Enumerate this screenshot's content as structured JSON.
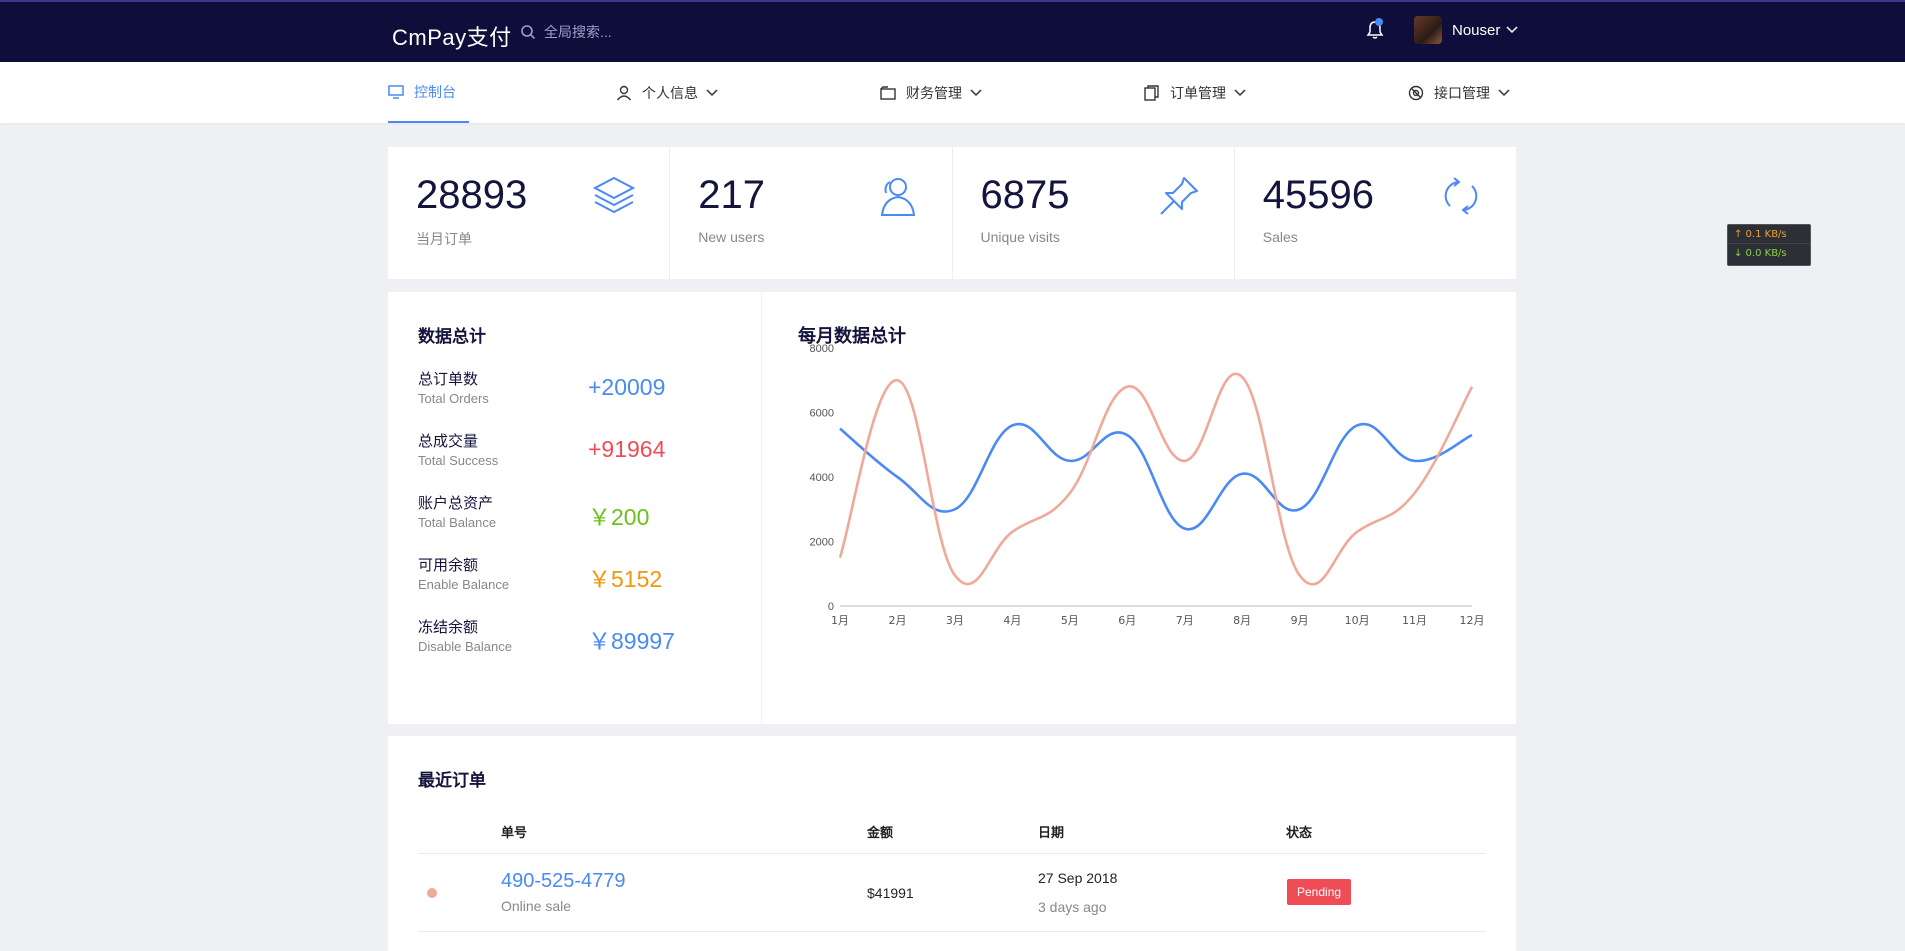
{
  "header": {
    "logo": "CmPay支付",
    "search_placeholder": "全局搜索...",
    "username": "Nouser"
  },
  "nav": [
    {
      "label": "控制台",
      "icon": "monitor-icon",
      "active": true
    },
    {
      "label": "个人信息",
      "icon": "user-icon"
    },
    {
      "label": "财务管理",
      "icon": "wallet-icon"
    },
    {
      "label": "订单管理",
      "icon": "document-copy-icon"
    },
    {
      "label": "接口管理",
      "icon": "api-icon"
    }
  ],
  "stats": [
    {
      "value": "28893",
      "label": "当月订单",
      "icon": "layers-icon"
    },
    {
      "value": "217",
      "label": "New users",
      "icon": "users-icon"
    },
    {
      "value": "6875",
      "label": "Unique visits",
      "icon": "pin-icon"
    },
    {
      "value": "45596",
      "label": "Sales",
      "icon": "refresh-icon"
    }
  ],
  "summary": {
    "title": "数据总计",
    "rows": [
      {
        "cn": "总订单数",
        "en": "Total Orders",
        "value": "+20009",
        "color": "#4a8af4"
      },
      {
        "cn": "总成交量",
        "en": "Total Success",
        "value": "+91964",
        "color": "#ef4d55"
      },
      {
        "cn": "账户总资产",
        "en": "Total Balance",
        "value": "￥200",
        "color": "#6cc01c"
      },
      {
        "cn": "可用余额",
        "en": "Enable Balance",
        "value": "￥5152",
        "color": "#f0960e"
      },
      {
        "cn": "冻结余额",
        "en": "Disable Balance",
        "value": "￥89997",
        "color": "#4a8af4"
      }
    ]
  },
  "chart_title": "每月数据总计",
  "chart_data": {
    "type": "line",
    "categories": [
      "1月",
      "2月",
      "3月",
      "4月",
      "5月",
      "6月",
      "7月",
      "8月",
      "9月",
      "10月",
      "11月",
      "12月"
    ],
    "ylim": [
      0,
      8000
    ],
    "yticks": [
      0,
      2000,
      4000,
      6000,
      8000
    ],
    "series": [
      {
        "color": "#4a8af4",
        "values": [
          5500,
          4000,
          3000,
          5600,
          4500,
          5300,
          2400,
          4100,
          3000,
          5600,
          4500,
          5300
        ]
      },
      {
        "color": "#f0a898",
        "values": [
          1500,
          7000,
          950,
          2300,
          3500,
          6800,
          4500,
          7100,
          950,
          2300,
          3500,
          6800
        ]
      }
    ]
  },
  "orders": {
    "title": "最近订单",
    "columns": [
      "单号",
      "金额",
      "日期",
      "状态"
    ],
    "rows": [
      {
        "id": "490-525-4779",
        "sub": "Online sale",
        "amount": "$41991",
        "date": "27 Sep 2018",
        "ago": "3 days ago",
        "status": "Pending"
      }
    ]
  },
  "netmon": {
    "up": "↑ 0.1 KB/s",
    "down": "↓ 0.0 KB/s"
  }
}
